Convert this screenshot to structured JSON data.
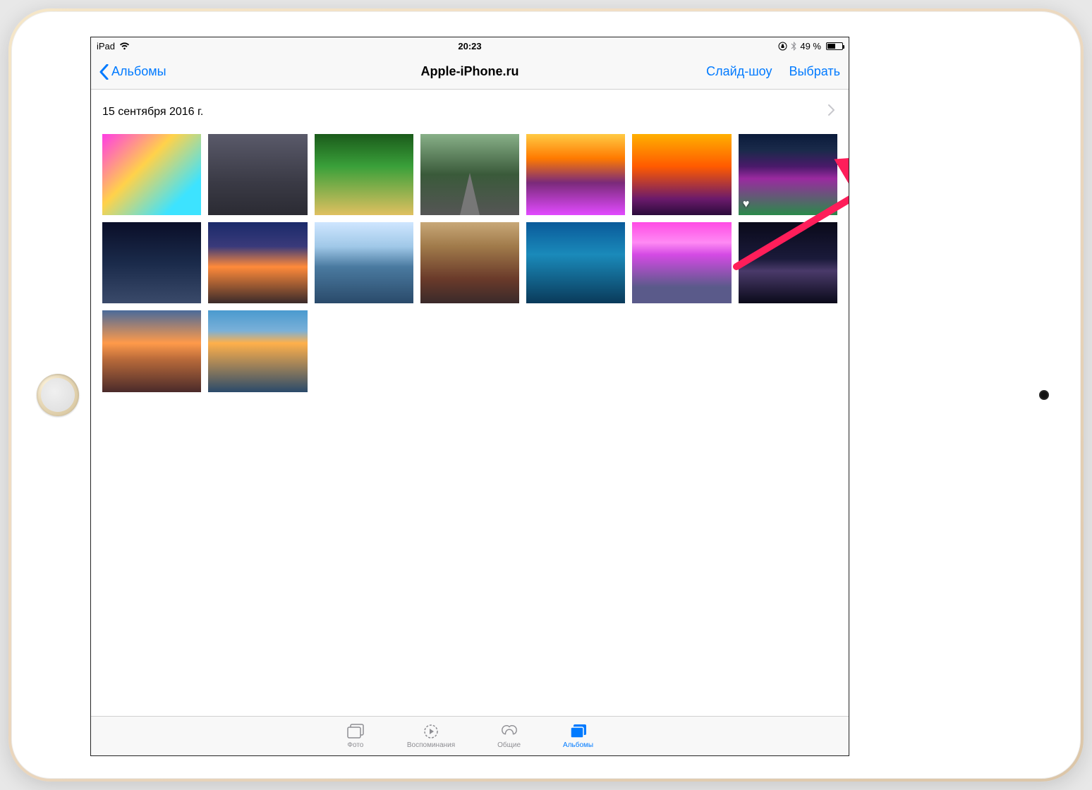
{
  "statusBar": {
    "device": "iPad",
    "time": "20:23",
    "batteryText": "49 %",
    "batteryLevel": 49
  },
  "navBar": {
    "backLabel": "Альбомы",
    "title": "Apple-iPhone.ru",
    "slideshowLabel": "Слайд-шоу",
    "selectLabel": "Выбрать"
  },
  "section": {
    "dateLabel": "15 сентября 2016 г."
  },
  "photos": [
    {
      "desc": "colorful-clouds",
      "favorite": false
    },
    {
      "desc": "city-skyline-night",
      "favorite": false
    },
    {
      "desc": "tree-lined-road-green",
      "favorite": false
    },
    {
      "desc": "forest-road-vanishing",
      "favorite": false
    },
    {
      "desc": "mountain-sunset-flower-field",
      "favorite": false
    },
    {
      "desc": "ocean-sunset",
      "favorite": false
    },
    {
      "desc": "lavender-field-tree",
      "favorite": true
    },
    {
      "desc": "motorcycle-dark-water",
      "favorite": false
    },
    {
      "desc": "sunset-over-sea",
      "favorite": false
    },
    {
      "desc": "snowy-mountains-lake",
      "favorite": false
    },
    {
      "desc": "rocky-mountain-sunset",
      "favorite": false
    },
    {
      "desc": "coral-reef-underwater",
      "favorite": false
    },
    {
      "desc": "pink-sky-mountains",
      "favorite": false
    },
    {
      "desc": "milky-way-forest",
      "favorite": false
    },
    {
      "desc": "volcano-sunrise",
      "favorite": false
    },
    {
      "desc": "mountain-lake-reflection",
      "favorite": false
    }
  ],
  "tabBar": {
    "photos": "Фото",
    "memories": "Воспоминания",
    "shared": "Общие",
    "albums": "Альбомы",
    "activeTab": "albums"
  },
  "colors": {
    "tint": "#007aff",
    "gray": "#8e8e93",
    "barBg": "#f8f8f8",
    "arrow": "#ff1e5a"
  }
}
